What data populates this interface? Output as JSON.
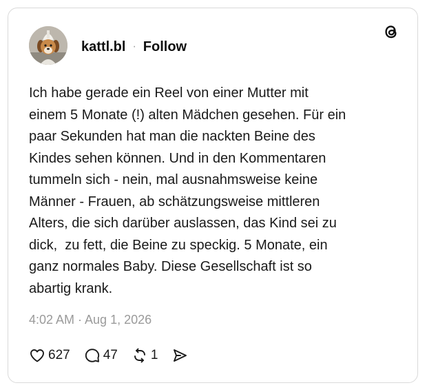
{
  "post": {
    "username": "kattl.bl",
    "separator": "·",
    "follow_label": "Follow",
    "text": "Ich habe gerade ein Reel von einer Mutter mit\neinem 5 Monate (!) alten Mädchen gesehen. Für ein\npaar Sekunden hat man die nackten Beine des\nKindes sehen können. Und in den Kommentaren\ntummeln sich - nein, mal ausnahmsweise keine\nMänner - Frauen, ab schätzungsweise mittleren\nAlters, die sich darüber auslassen, das Kind sei zu\ndick,  zu fett, die Beine zu speckig. 5 Monate, ein\nganz normales Baby. Diese Gesellschaft ist so\nabartig krank.",
    "timestamp": "4:02 AM · Aug 1, 2026"
  },
  "actions": {
    "likes": "627",
    "replies": "47",
    "reposts": "1"
  },
  "icons": {
    "brand": "threads-logo-icon",
    "like": "heart-icon",
    "reply": "comment-bubble-icon",
    "repost": "repost-icon",
    "share": "share-send-icon"
  },
  "colors": {
    "text": "#101010",
    "muted": "#9a9a9a",
    "border": "#d9d9d9"
  }
}
